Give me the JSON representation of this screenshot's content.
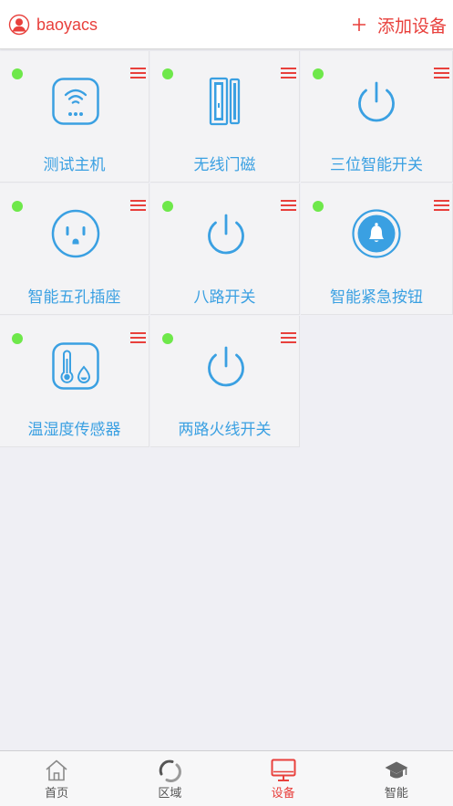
{
  "header": {
    "username": "baoyacs",
    "user_icon": "user-avatar-icon",
    "add_icon": "plus-icon",
    "add_label": "添加设备"
  },
  "colors": {
    "accent": "#e8403c",
    "device_blue": "#3aa0e2",
    "online": "#6ee84a",
    "background": "#efeff4"
  },
  "devices": [
    {
      "name": "测试主机",
      "icon": "wifi-hub-icon",
      "online": true
    },
    {
      "name": "无线门磁",
      "icon": "door-sensor-icon",
      "online": true
    },
    {
      "name": "三位智能开关",
      "icon": "power-icon",
      "online": true
    },
    {
      "name": "智能五孔插座",
      "icon": "socket-icon",
      "online": true
    },
    {
      "name": "八路开关",
      "icon": "power-icon",
      "online": true
    },
    {
      "name": "智能紧急按钮",
      "icon": "bell-icon",
      "online": true
    },
    {
      "name": "温湿度传感器",
      "icon": "thermometer-icon",
      "online": true
    },
    {
      "name": "两路火线开关",
      "icon": "power-icon",
      "online": true
    }
  ],
  "tabs": [
    {
      "label": "首页",
      "icon": "home-icon",
      "active": false
    },
    {
      "label": "区域",
      "icon": "area-icon",
      "active": false
    },
    {
      "label": "设备",
      "icon": "monitor-icon",
      "active": true
    },
    {
      "label": "智能",
      "icon": "graduation-cap-icon",
      "active": false
    }
  ]
}
